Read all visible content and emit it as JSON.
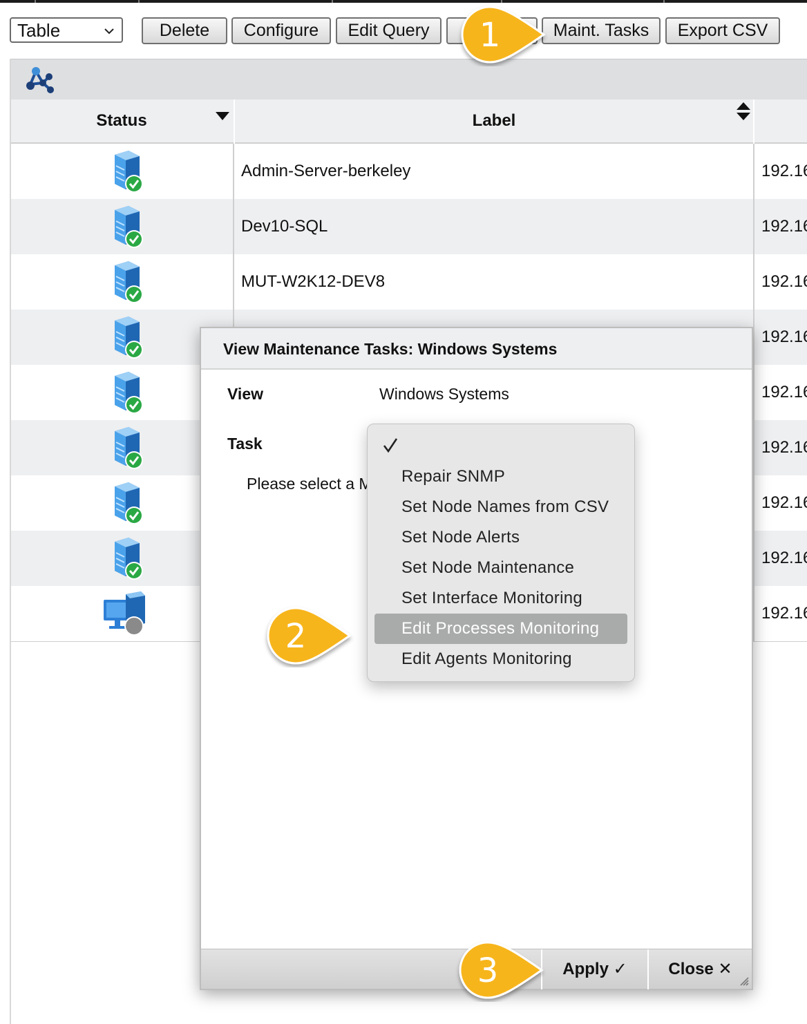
{
  "toolbar": {
    "view_select": "Table",
    "buttons": {
      "delete": "Delete",
      "configure": "Configure",
      "edit_query": "Edit Query",
      "maint_tasks": "Maint. Tasks",
      "export_csv": "Export CSV"
    }
  },
  "grid": {
    "columns": {
      "status": "Status",
      "label": "Label"
    },
    "rows": [
      {
        "label": "Admin-Server-berkeley",
        "ip": "192.16",
        "status": "ok"
      },
      {
        "label": "Dev10-SQL",
        "ip": "192.16",
        "status": "ok"
      },
      {
        "label": "MUT-W2K12-DEV8",
        "ip": "192.16",
        "status": "ok"
      },
      {
        "label": "",
        "ip": "192.16",
        "status": "ok"
      },
      {
        "label": "",
        "ip": "192.16",
        "status": "ok"
      },
      {
        "label": "",
        "ip": "192.16",
        "status": "ok"
      },
      {
        "label": "",
        "ip": "192.16",
        "status": "ok"
      },
      {
        "label": "",
        "ip": "192.16",
        "status": "ok"
      },
      {
        "label": "",
        "ip": "192.16",
        "status": "unknown"
      }
    ]
  },
  "dialog": {
    "title": "View Maintenance Tasks: Windows Systems",
    "view_label": "View",
    "view_value": "Windows Systems",
    "task_label": "Task",
    "hint": "Please select a M",
    "apply": "Apply ✓",
    "close": "Close ✕"
  },
  "task_menu": {
    "items": [
      "Repair SNMP",
      "Set Node Names from CSV",
      "Set Node Alerts",
      "Set Node Maintenance",
      "Set Interface Monitoring",
      "Edit Processes Monitoring",
      "Edit Agents Monitoring"
    ],
    "selected": "Edit Processes Monitoring"
  },
  "callouts": [
    "1",
    "2",
    "3"
  ],
  "colors": {
    "callout": "#f7b51c",
    "status_ok": "#2aa844",
    "status_unknown": "#8a8a8a",
    "server_blue": "#3a8fd9",
    "menu_selected": "#a9abaa"
  }
}
